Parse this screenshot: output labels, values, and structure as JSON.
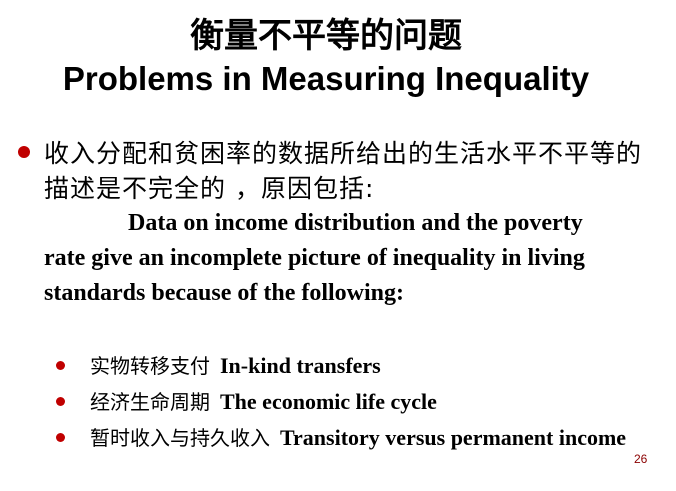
{
  "title": {
    "zh": "衡量不平等的问题",
    "en": "Problems in Measuring Inequality"
  },
  "main_bullet": {
    "zh": "收入分配和贫困率的数据所给出的生活水平不平等的描述是不完全的 ，原因包括:",
    "en": "Data on income distribution and the poverty rate give an incomplete picture of inequality in living standards because of the following:"
  },
  "sub_bullets": [
    {
      "zh": "实物转移支付",
      "en": "In-kind transfers"
    },
    {
      "zh": "经济生命周期",
      "en": "The economic life cycle"
    },
    {
      "zh": "暂时收入与持久收入",
      "en": "Transitory versus permanent income"
    }
  ],
  "page_number": "26",
  "colors": {
    "bullet": "#c00000",
    "page_number": "#8b0000"
  }
}
